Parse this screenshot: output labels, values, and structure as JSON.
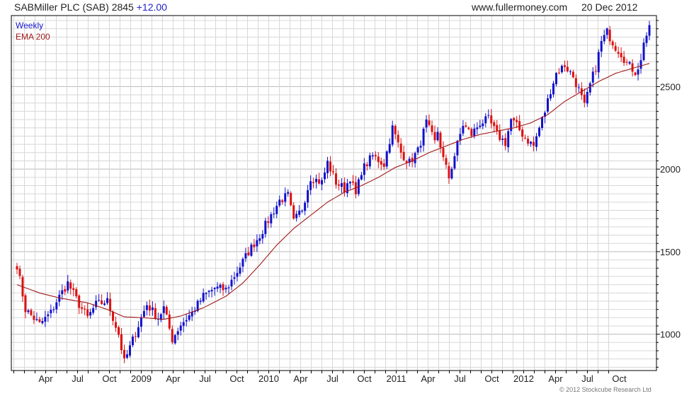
{
  "header": {
    "title": "SABMiller PLC (SAB) 2845",
    "change": "+12.00",
    "website": "www.fullermoney.com",
    "date": "20 Dec 2012"
  },
  "footer": {
    "copyright": "© 2012 Stockcube Research Ltd"
  },
  "colors": {
    "up": "#1111cc",
    "down": "#dd1111",
    "ema": "#a01a1a",
    "grid": "#d7d7d7",
    "axis": "#000000"
  },
  "chart_data": {
    "type": "candlestick",
    "period": "Weekly",
    "legend": [
      {
        "name": "Weekly",
        "color": "#1111cc"
      },
      {
        "name": "EMA 200",
        "color": "#a01a1a"
      }
    ],
    "x_tick_labels": [
      "Apr",
      "Jul",
      "Oct",
      "2009",
      "Apr",
      "Jul",
      "Oct",
      "2010",
      "Apr",
      "Jul",
      "Oct",
      "2011",
      "Apr",
      "Jul",
      "Oct",
      "2012",
      "Apr",
      "Jul",
      "Oct"
    ],
    "y_ticks": [
      1000,
      1500,
      2000,
      2500
    ],
    "ylim": [
      780,
      2930
    ],
    "close_path": [
      [
        0,
        1420
      ],
      [
        3,
        1150
      ],
      [
        8,
        1060
      ],
      [
        12,
        1130
      ],
      [
        14,
        1200
      ],
      [
        18,
        1310
      ],
      [
        22,
        1180
      ],
      [
        25,
        1100
      ],
      [
        28,
        1180
      ],
      [
        32,
        1200
      ],
      [
        36,
        1000
      ],
      [
        38,
        830
      ],
      [
        42,
        1010
      ],
      [
        44,
        1100
      ],
      [
        46,
        1180
      ],
      [
        50,
        1100
      ],
      [
        52,
        1160
      ],
      [
        55,
        970
      ],
      [
        58,
        1060
      ],
      [
        62,
        1130
      ],
      [
        66,
        1230
      ],
      [
        70,
        1280
      ],
      [
        74,
        1270
      ],
      [
        78,
        1380
      ],
      [
        82,
        1500
      ],
      [
        86,
        1600
      ],
      [
        90,
        1720
      ],
      [
        93,
        1810
      ],
      [
        96,
        1840
      ],
      [
        98,
        1680
      ],
      [
        101,
        1760
      ],
      [
        104,
        1950
      ],
      [
        108,
        1920
      ],
      [
        110,
        2040
      ],
      [
        113,
        1920
      ],
      [
        116,
        1880
      ],
      [
        118,
        1950
      ],
      [
        120,
        1840
      ],
      [
        122,
        1990
      ],
      [
        126,
        2080
      ],
      [
        130,
        2030
      ],
      [
        133,
        2250
      ],
      [
        136,
        2100
      ],
      [
        139,
        2040
      ],
      [
        142,
        2110
      ],
      [
        145,
        2280
      ],
      [
        148,
        2160
      ],
      [
        149,
        2230
      ],
      [
        151,
        2060
      ],
      [
        153,
        1950
      ],
      [
        156,
        2150
      ],
      [
        158,
        2270
      ],
      [
        161,
        2210
      ],
      [
        164,
        2280
      ],
      [
        167,
        2300
      ],
      [
        170,
        2210
      ],
      [
        173,
        2160
      ],
      [
        175,
        2300
      ],
      [
        177,
        2260
      ],
      [
        180,
        2190
      ],
      [
        183,
        2140
      ],
      [
        185,
        2250
      ],
      [
        187,
        2350
      ],
      [
        189,
        2480
      ],
      [
        191,
        2580
      ],
      [
        194,
        2630
      ],
      [
        197,
        2560
      ],
      [
        199,
        2480
      ],
      [
        201,
        2380
      ],
      [
        203,
        2510
      ],
      [
        205,
        2620
      ],
      [
        207,
        2770
      ],
      [
        209,
        2830
      ],
      [
        212,
        2740
      ],
      [
        214,
        2700
      ],
      [
        216,
        2640
      ],
      [
        219,
        2590
      ],
      [
        221,
        2650
      ],
      [
        222,
        2780
      ],
      [
        223,
        2810
      ],
      [
        224,
        2845
      ]
    ],
    "ema_path": [
      [
        0,
        1300
      ],
      [
        8,
        1250
      ],
      [
        15,
        1220
      ],
      [
        25,
        1190
      ],
      [
        32,
        1150
      ],
      [
        38,
        1105
      ],
      [
        45,
        1100
      ],
      [
        52,
        1090
      ],
      [
        58,
        1110
      ],
      [
        66,
        1160
      ],
      [
        74,
        1230
      ],
      [
        80,
        1310
      ],
      [
        86,
        1420
      ],
      [
        92,
        1540
      ],
      [
        98,
        1640
      ],
      [
        104,
        1720
      ],
      [
        110,
        1800
      ],
      [
        116,
        1860
      ],
      [
        122,
        1900
      ],
      [
        128,
        1950
      ],
      [
        134,
        2010
      ],
      [
        140,
        2050
      ],
      [
        146,
        2100
      ],
      [
        152,
        2140
      ],
      [
        158,
        2180
      ],
      [
        164,
        2210
      ],
      [
        170,
        2230
      ],
      [
        176,
        2250
      ],
      [
        182,
        2280
      ],
      [
        188,
        2330
      ],
      [
        194,
        2410
      ],
      [
        200,
        2470
      ],
      [
        206,
        2530
      ],
      [
        212,
        2580
      ],
      [
        218,
        2610
      ],
      [
        224,
        2640
      ]
    ]
  }
}
